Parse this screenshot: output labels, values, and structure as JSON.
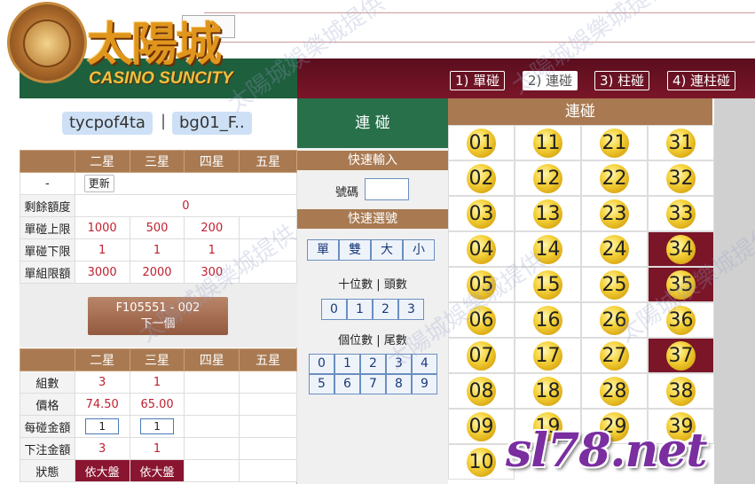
{
  "header": {
    "logo_cn": "太陽城",
    "logo_en": "CASINO SUNCITY",
    "tabs": [
      {
        "label": "1) 單碰",
        "active": false
      },
      {
        "label": "2) 連碰",
        "active": true
      },
      {
        "label": "3) 柱碰",
        "active": false
      },
      {
        "label": "4) 連柱碰",
        "active": false
      }
    ]
  },
  "user": {
    "name": "tycpof4ta",
    "account": "bg01_F..",
    "separator": "|"
  },
  "limits": {
    "columns": [
      "",
      "二星",
      "三星",
      "四星",
      "五星"
    ],
    "update_row": {
      "label": "-",
      "button": "更新"
    },
    "remaining": {
      "label": "剩餘額度",
      "value": "0"
    },
    "rows": [
      {
        "label": "單碰上限",
        "values": [
          "1000",
          "500",
          "200",
          ""
        ]
      },
      {
        "label": "單碰下限",
        "values": [
          "1",
          "1",
          "1",
          ""
        ]
      },
      {
        "label": "單組限額",
        "values": [
          "3000",
          "2000",
          "300",
          ""
        ]
      }
    ]
  },
  "code_button": {
    "line1": "F105551 - 002",
    "line2": "下一個"
  },
  "bet": {
    "columns": [
      "",
      "二星",
      "三星",
      "四星",
      "五星"
    ],
    "groups": {
      "label": "組數",
      "values": [
        "3",
        "1",
        "",
        ""
      ]
    },
    "price": {
      "label": "價格",
      "values": [
        "74.50",
        "65.00",
        "",
        ""
      ]
    },
    "per_amount": {
      "label": "每碰金額",
      "values": [
        "1",
        "1"
      ]
    },
    "total": {
      "label": "下注金額",
      "values": [
        "3",
        "1",
        "",
        ""
      ]
    },
    "status": {
      "label": "狀態",
      "values": [
        "依大盤",
        "依大盤"
      ]
    }
  },
  "middle": {
    "title": "連 碰",
    "quick_input": "快速輸入",
    "number_label": "號碼",
    "quick_select": "快速選號",
    "parity": [
      "單",
      "雙",
      "大",
      "小"
    ],
    "tens_label": "十位數 | 頭數",
    "tens": [
      "0",
      "1",
      "2",
      "3"
    ],
    "units_label": "個位數 | 尾數",
    "units": [
      "0",
      "1",
      "2",
      "3",
      "4",
      "5",
      "6",
      "7",
      "8",
      "9"
    ]
  },
  "grid": {
    "title": "連碰",
    "numbers": [
      "01",
      "11",
      "21",
      "31",
      "02",
      "12",
      "22",
      "32",
      "03",
      "13",
      "23",
      "33",
      "04",
      "14",
      "24",
      "34",
      "05",
      "15",
      "25",
      "35",
      "06",
      "16",
      "26",
      "36",
      "07",
      "17",
      "27",
      "37",
      "08",
      "18",
      "28",
      "38",
      "09",
      "19",
      "29",
      "39",
      "10"
    ],
    "selected": [
      "34",
      "35",
      "37"
    ]
  },
  "watermark": "太陽城娛樂城提供",
  "brand_overlay": "sl78.net"
}
